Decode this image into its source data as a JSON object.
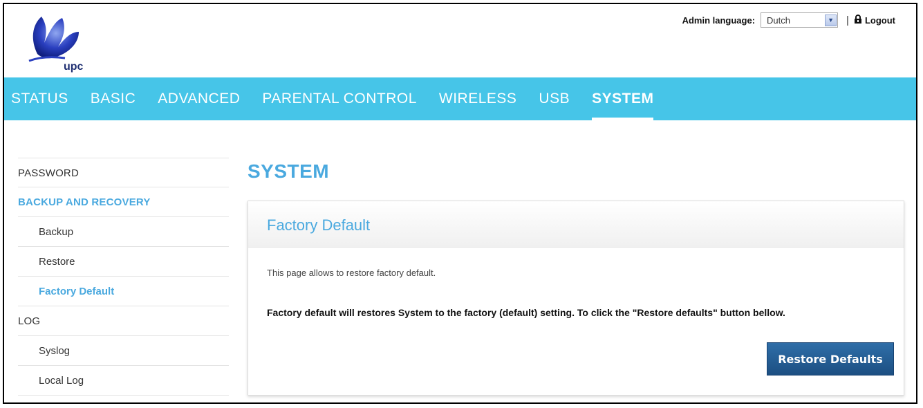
{
  "header": {
    "logo_text": "upc",
    "admin_language_label": "Admin language:",
    "language_selected": "Dutch",
    "separator": "|",
    "logout_label": "Logout"
  },
  "nav": {
    "items": [
      {
        "label": "STATUS"
      },
      {
        "label": "BASIC"
      },
      {
        "label": "ADVANCED"
      },
      {
        "label": "PARENTAL CONTROL"
      },
      {
        "label": "WIRELESS"
      },
      {
        "label": "USB"
      },
      {
        "label": "SYSTEM",
        "active": true
      }
    ]
  },
  "sidebar": {
    "items": [
      {
        "label": "PASSWORD",
        "type": "category"
      },
      {
        "label": "BACKUP AND RECOVERY",
        "type": "category",
        "active": true
      },
      {
        "label": "Backup",
        "type": "sub"
      },
      {
        "label": "Restore",
        "type": "sub"
      },
      {
        "label": "Factory Default",
        "type": "sub",
        "active": true
      },
      {
        "label": "LOG",
        "type": "category"
      },
      {
        "label": "Syslog",
        "type": "sub"
      },
      {
        "label": "Local Log",
        "type": "sub"
      }
    ]
  },
  "main": {
    "page_title": "SYSTEM",
    "panel": {
      "title": "Factory Default",
      "description": "This page allows to restore factory default.",
      "note": "Factory default will restores System to the factory (default) setting. To click the \"Restore defaults\" button bellow.",
      "button_label": "Restore Defaults"
    }
  },
  "colors": {
    "accent": "#4aa9df",
    "nav_bg": "#46c5e8",
    "button_bg": "#1c4f82"
  }
}
